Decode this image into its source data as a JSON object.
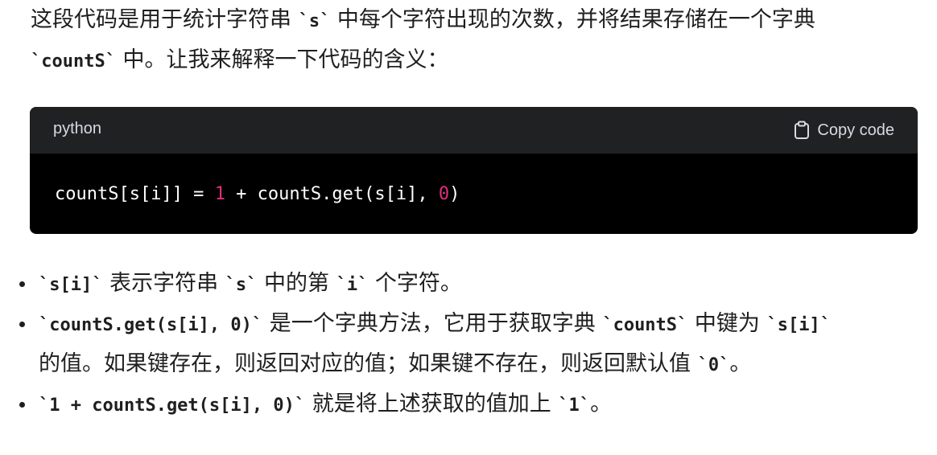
{
  "intro": {
    "line1_a": "这段代码是用于统计字符串 ",
    "line1_code": "`s`",
    "line1_b": " 中每个字符出现的次数，并将结果存储在一个字典",
    "line2_code": "`countS`",
    "line2_b": " 中。让我来解释一下代码的含义："
  },
  "code_block": {
    "language": "python",
    "copy_label": "Copy code",
    "code_a": "countS[s[i]] = ",
    "num1": "1",
    "code_b": " + countS.get(s[i], ",
    "num2": "0",
    "code_c": ")"
  },
  "bullets": [
    {
      "code1": "`s[i]`",
      "t1": " 表示字符串 ",
      "code2": "`s`",
      "t2": " 中的第 ",
      "code3": "`i`",
      "t3": " 个字符。"
    },
    {
      "code1": "`countS.get(s[i], 0)`",
      "t1": " 是一个字典方法，它用于获取字典 ",
      "code2": "`countS`",
      "t2": " 中键为 ",
      "code3": "`s[i]`",
      "l2_t1": "的值。如果键存在，则返回对应的值；如果键不存在，则返回默认值 ",
      "l2_code": "`0`",
      "l2_t2": "。"
    },
    {
      "code1": "`1 + countS.get(s[i], 0)`",
      "t1": " 就是将上述获取的值加上 ",
      "code2": "`1`",
      "t2": "。"
    }
  ]
}
